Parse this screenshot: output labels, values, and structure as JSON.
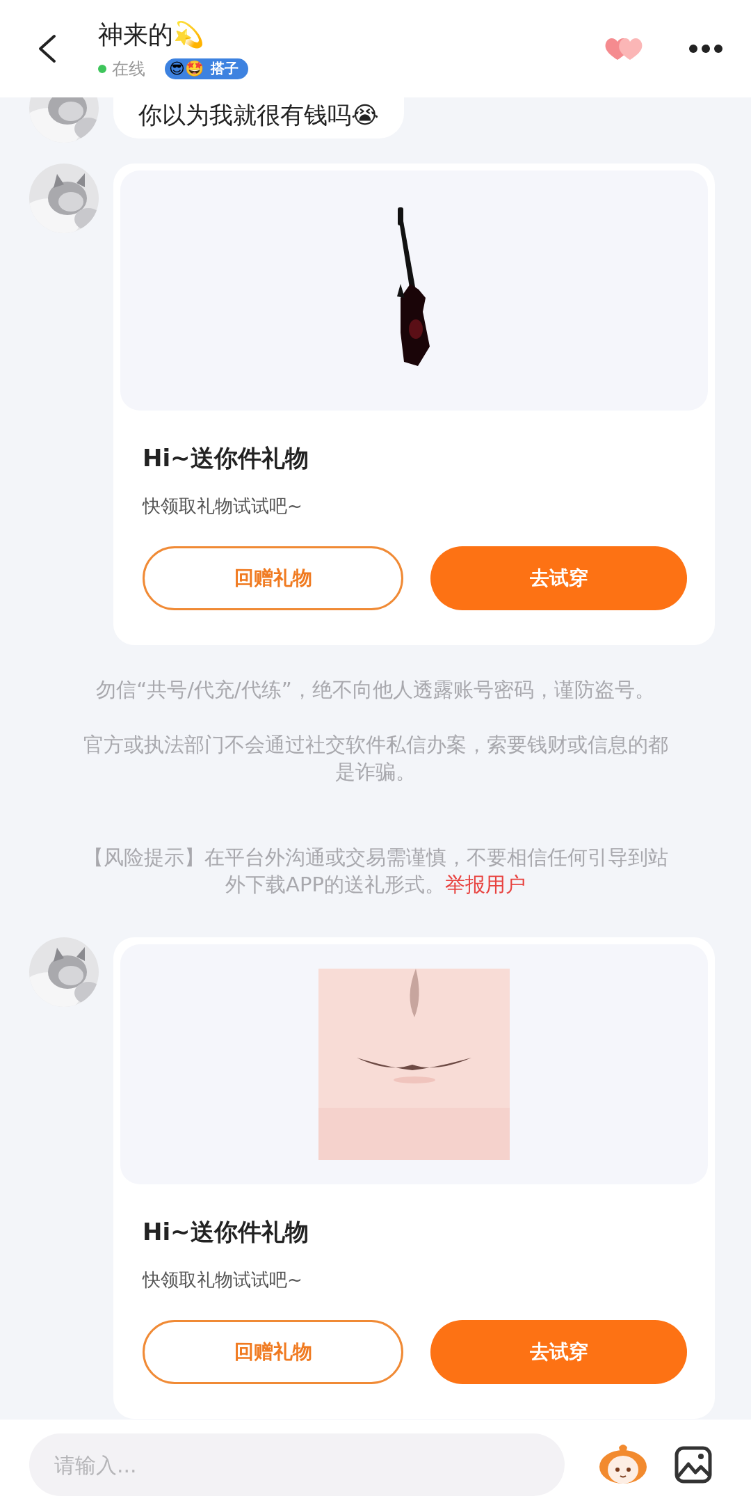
{
  "header": {
    "title": "神来的💫",
    "status": {
      "label": "在线",
      "online": true
    },
    "tag": {
      "emoji": "😎🤩",
      "label": "搭子"
    }
  },
  "messages": [
    {
      "kind": "text",
      "text": "你以为我就很有钱吗😭"
    },
    {
      "kind": "gift",
      "title": "Hi~送你件礼物",
      "subtitle": "快领取礼物试试吧~",
      "buttons": [
        {
          "label": "回赠礼物",
          "kind": "outline"
        },
        {
          "label": "去试穿",
          "kind": "filled"
        }
      ]
    },
    {
      "kind": "notice",
      "paragraphs": [
        {
          "text": "勿信“共号/代充/代练”，绝不向他人透露账号密码，谨防盗号。"
        },
        {
          "text": "官方或执法部门不会通过社交软件私信办案，索要钱财或信息的都是诈骗。"
        },
        {
          "text": "【风险提示】在平台外沟通或交易需谨慎，不要相信任何引导到站外下载APP的送礼形式。",
          "link": "举报用户"
        }
      ]
    },
    {
      "kind": "gift",
      "title": "Hi~送你件礼物",
      "subtitle": "快领取礼物试试吧~",
      "buttons": [
        {
          "label": "回赠礼物",
          "kind": "outline"
        },
        {
          "label": "去试穿",
          "kind": "filled"
        }
      ]
    }
  ],
  "composer": {
    "placeholder": "请输入..."
  }
}
